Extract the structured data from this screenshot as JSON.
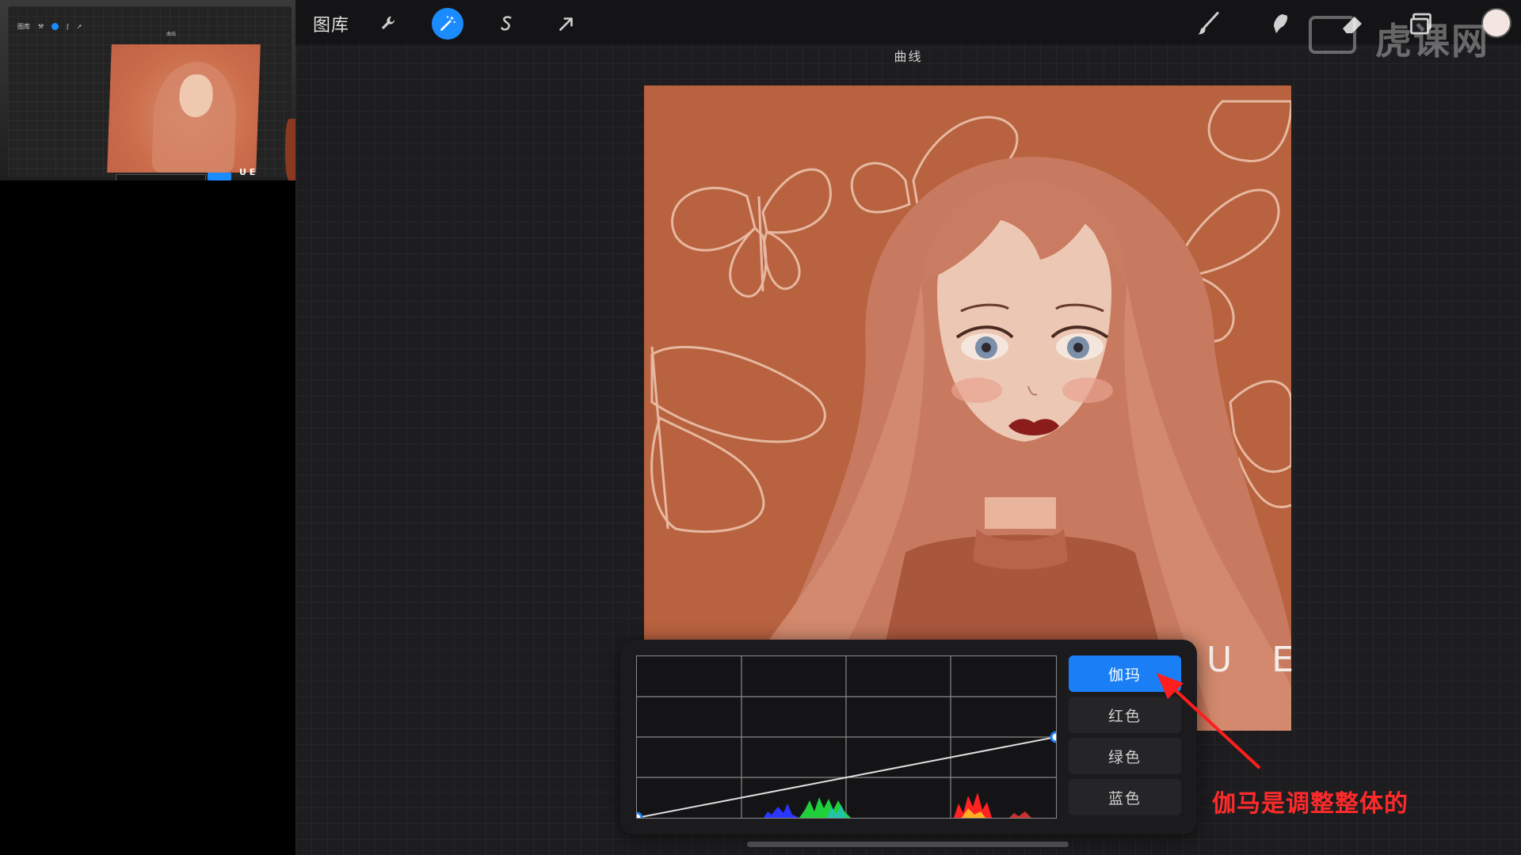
{
  "pip": {
    "toolbar_label": "图库",
    "mode_title": "曲线",
    "ue_text": "U E"
  },
  "topbar": {
    "gallery_label": "图库",
    "tools": [
      {
        "name": "wrench-icon",
        "active": false
      },
      {
        "name": "magic-wand-icon",
        "active": true
      },
      {
        "name": "selection-s-icon",
        "active": false
      },
      {
        "name": "transform-arrow-icon",
        "active": false
      }
    ],
    "right_tools": [
      "brush-icon",
      "smudge-icon",
      "eraser-icon",
      "layers-icon"
    ],
    "color_swatch": "#f3e6e0"
  },
  "watermark": {
    "text": "虎课网"
  },
  "mode_title": "曲线",
  "artwork": {
    "overlay_text": "U E",
    "background_color": "#b8623f"
  },
  "curves": {
    "channels": [
      {
        "label": "伽玛",
        "active": true
      },
      {
        "label": "红色",
        "active": false
      },
      {
        "label": "绿色",
        "active": false
      },
      {
        "label": "蓝色",
        "active": false
      }
    ],
    "curve_points": [
      [
        0,
        0
      ],
      [
        1,
        0.5
      ]
    ],
    "accent_color": "#1a7ff5"
  },
  "annotation": {
    "text": "伽马是调整整体的",
    "color": "#ff2a2a"
  }
}
